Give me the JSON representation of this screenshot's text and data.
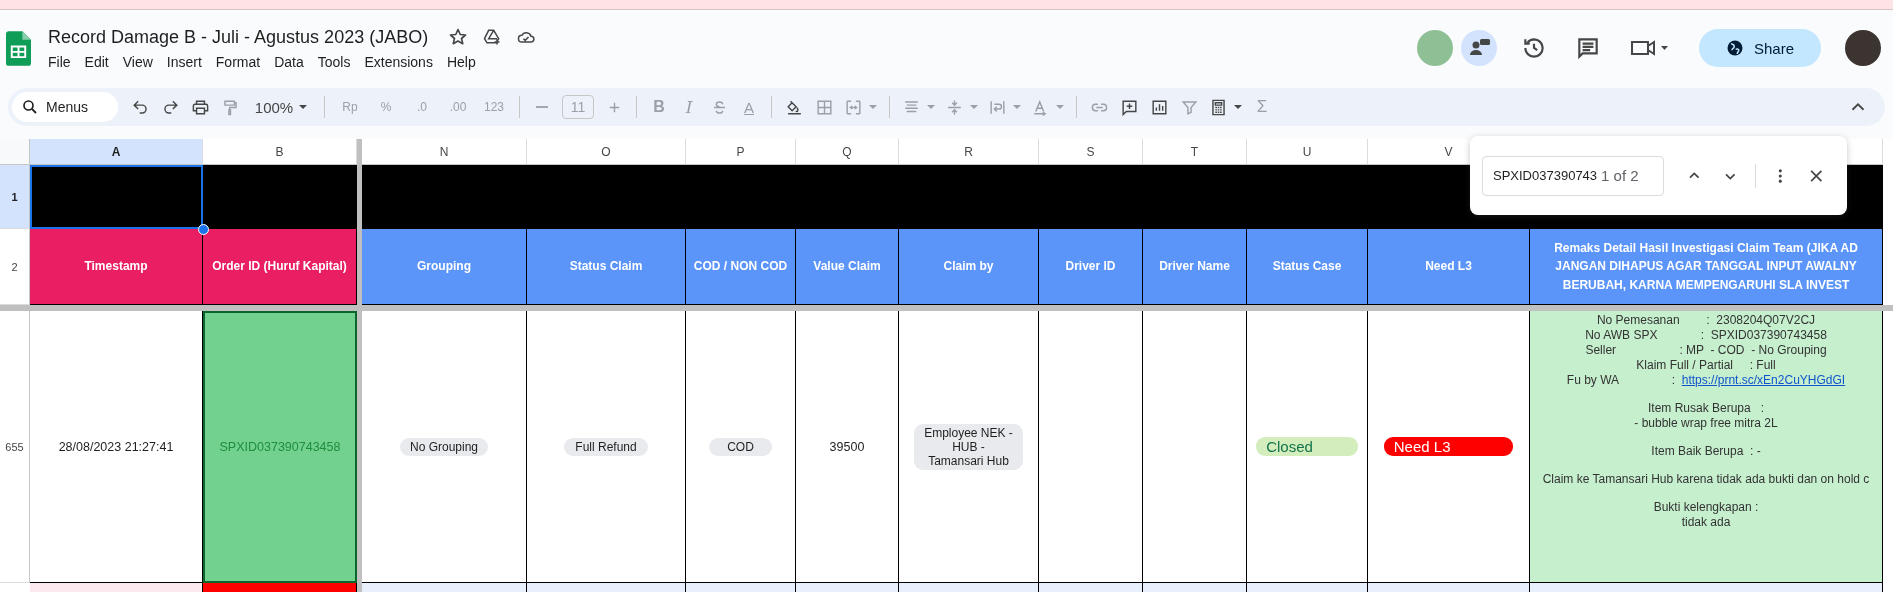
{
  "doc": {
    "title": "Record Damage B - Juli - Agustus 2023 (JABO)",
    "starred": false
  },
  "menu": [
    "File",
    "Edit",
    "View",
    "Insert",
    "Format",
    "Data",
    "Tools",
    "Extensions",
    "Help"
  ],
  "share": {
    "label": "Share"
  },
  "toolbar": {
    "search_placeholder": "Menus",
    "groups": [
      [
        {
          "kind": "undo",
          "disabled": false
        },
        {
          "kind": "redo",
          "disabled": false
        },
        {
          "kind": "print",
          "disabled": false
        },
        {
          "kind": "paint",
          "disabled": true
        },
        {
          "kind": "zoom",
          "label": "100%",
          "disabled": false
        }
      ],
      [
        {
          "kind": "text",
          "label": "Rp",
          "disabled": true
        },
        {
          "kind": "text",
          "label": "%",
          "disabled": true
        },
        {
          "kind": "text",
          "label": ".0",
          "disabled": true
        },
        {
          "kind": "text",
          "label": ".00",
          "disabled": true
        },
        {
          "kind": "text",
          "label": "123",
          "disabled": true
        }
      ],
      [
        {
          "kind": "minus",
          "disabled": true
        },
        {
          "kind": "size",
          "label": "11",
          "disabled": true
        },
        {
          "kind": "plus",
          "disabled": true
        }
      ],
      [
        {
          "kind": "bold",
          "label": "B",
          "disabled": true
        },
        {
          "kind": "italic",
          "label": "I",
          "disabled": true
        },
        {
          "kind": "strike",
          "disabled": true
        },
        {
          "kind": "color",
          "label": "A",
          "disabled": true
        }
      ],
      [
        {
          "kind": "fill",
          "disabled": false
        },
        {
          "kind": "borders",
          "disabled": true
        },
        {
          "kind": "merge",
          "disabled": true
        }
      ],
      [
        {
          "kind": "halign",
          "disabled": true
        },
        {
          "kind": "valign",
          "disabled": true
        },
        {
          "kind": "wrap",
          "disabled": true
        },
        {
          "kind": "rotate",
          "disabled": true
        }
      ],
      [
        {
          "kind": "link",
          "disabled": true
        },
        {
          "kind": "comment",
          "disabled": false
        },
        {
          "kind": "chart",
          "disabled": false
        },
        {
          "kind": "filter",
          "disabled": true
        },
        {
          "kind": "filterviews",
          "disabled": false
        },
        {
          "kind": "sigma",
          "label": "Σ",
          "disabled": true
        }
      ]
    ]
  },
  "sheet": {
    "columns": [
      {
        "letter": "A",
        "selected": true
      },
      {
        "letter": "B",
        "selected": false
      },
      {
        "letter": "N",
        "selected": false
      },
      {
        "letter": "O",
        "selected": false
      },
      {
        "letter": "P",
        "selected": false
      },
      {
        "letter": "Q",
        "selected": false
      },
      {
        "letter": "R",
        "selected": false
      },
      {
        "letter": "S",
        "selected": false
      },
      {
        "letter": "T",
        "selected": false
      },
      {
        "letter": "U",
        "selected": false
      },
      {
        "letter": "V",
        "selected": false
      }
    ],
    "rows": [
      {
        "label": "1",
        "selected": true
      },
      {
        "label": "2",
        "selected": false
      },
      {
        "label": "655",
        "selected": false
      }
    ],
    "headings": [
      {
        "text": "Timestamp",
        "color": "#e91e63"
      },
      {
        "text": "Order ID (Huruf Kapital)",
        "color": "#e91e63"
      },
      {
        "text": "Grouping",
        "color": "#5b95f9"
      },
      {
        "text": "Status Claim",
        "color": "#5b95f9"
      },
      {
        "text": "COD / NON COD",
        "color": "#5b95f9"
      },
      {
        "text": "Value Claim",
        "color": "#5b95f9"
      },
      {
        "text": "Claim by",
        "color": "#5b95f9"
      },
      {
        "text": "Driver ID",
        "color": "#5b95f9"
      },
      {
        "text": "Driver Name",
        "color": "#5b95f9"
      },
      {
        "text": "Status Case",
        "color": "#5b95f9"
      },
      {
        "text": "Need L3",
        "color": "#5b95f9"
      },
      {
        "text": "Remaks Detail Hasil Investigasi Claim Team (JIKA AD\nJANGAN DIHAPUS AGAR TANGGAL INPUT AWALNY\nBERUBAH, KARNA MEMPENGARUHI SLA INVEST",
        "color": "#5b95f9"
      }
    ],
    "record": [
      {
        "kind": "text",
        "text": "28/08/2023 21:27:41",
        "highlighted": false
      },
      {
        "kind": "text",
        "text": "SPXID037390743458",
        "highlighted": true
      },
      {
        "kind": "chip",
        "text": "No Grouping"
      },
      {
        "kind": "chip",
        "text": "Full Refund"
      },
      {
        "kind": "chip",
        "text": "COD"
      },
      {
        "kind": "text",
        "text": "39500",
        "highlighted": false
      },
      {
        "kind": "chip",
        "text": "Employee NEK -\nHUB -\nTamansari Hub"
      },
      {
        "kind": "empty"
      },
      {
        "kind": "empty"
      },
      {
        "kind": "status",
        "text": "Closed",
        "color": "#d4edbc"
      },
      {
        "kind": "status",
        "text": "Need L3",
        "color": "#ff0000"
      },
      {
        "kind": "notes",
        "paragraphs": [
          {
            "lines": [
              {
                "text": "No Pemesanan        :  2308204Q07V2CJ"
              },
              {
                "text": "No AWB SPX             :  SPXID037390743458"
              },
              {
                "text": "Seller                   : MP  - COD  - No Grouping"
              },
              {
                "text": "Klaim Full / Partial     : Full"
              },
              {
                "text": "Fu by WA                :  ",
                "link": "https://prnt.sc/xEn2CuYHGdGI"
              }
            ]
          },
          {
            "lines": [
              {
                "text": "Item Rusak Berupa   :"
              },
              {
                "text": "- bubble wrap free mitra 2L"
              }
            ]
          },
          {
            "lines": [
              {
                "text": "Item Baik Berupa  : -"
              }
            ]
          },
          {
            "lines": [
              {
                "text": "Claim ke Tamansari Hub karena tidak ada bukti dan on hold c"
              }
            ]
          },
          {
            "lines": [
              {
                "text": "Bukti kelengkapan :"
              },
              {
                "text": "tidak ada"
              }
            ]
          }
        ]
      }
    ]
  },
  "find": {
    "value": "SPXID037390743",
    "count": "1 of 2"
  }
}
